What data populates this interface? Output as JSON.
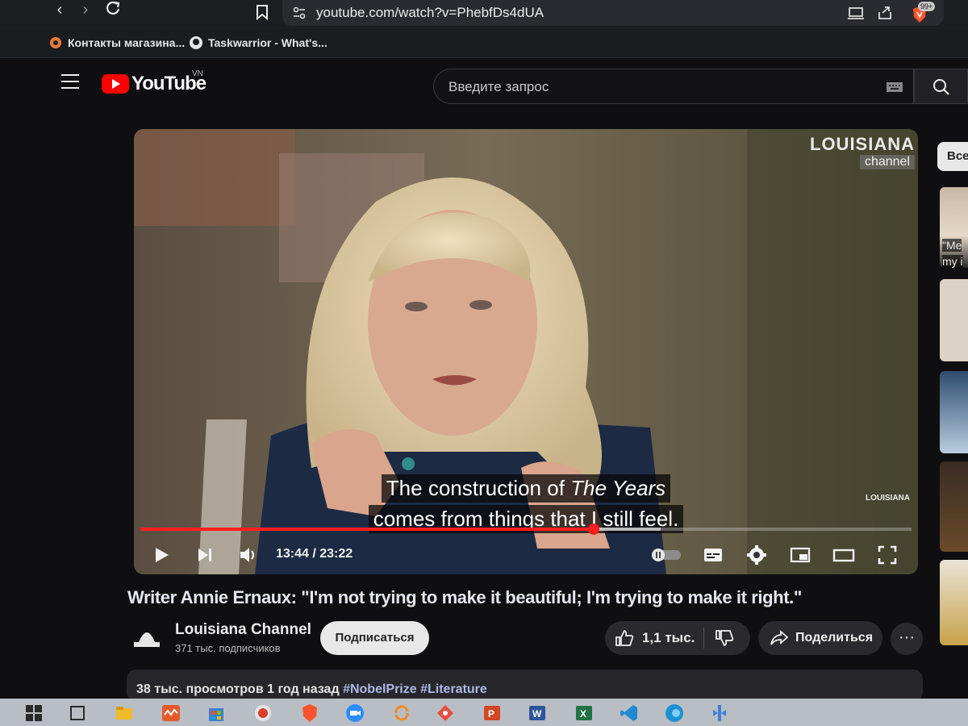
{
  "browser": {
    "url": "youtube.com/watch?v=PhebfDs4dUA",
    "badge_count": "99+",
    "bookmarks": [
      {
        "label": "Контакты магазина..."
      },
      {
        "label": "Taskwarrior - What's..."
      }
    ]
  },
  "header": {
    "logo_text": "YouTube",
    "country": "VN",
    "search_placeholder": "Введите запрос"
  },
  "player": {
    "watermark_main": "LOUISIANA",
    "watermark_sub": "channel",
    "watermark_small": "LOUISIANA",
    "caption_line1_a": "The construction of ",
    "caption_line1_b": "The Years",
    "caption_line2": "comes from things that I still feel.",
    "current_time": "13:44",
    "duration": "23:22",
    "time_display": "13:44 / 23:22",
    "progress_fraction": 0.588,
    "buffer_fraction": 0.675
  },
  "video": {
    "title": "Writer Annie Ernaux: \"I'm not trying to make it beautiful; I'm trying to make it right.\"",
    "channel_name": "Louisiana Channel",
    "subscribers": "371 тыс. подписчиков",
    "subscribe_label": "Подписаться",
    "likes": "1,1 тыс.",
    "share_label": "Поделиться",
    "more_label": "···",
    "views_date": "38 тыс. просмотров  1 год назад ",
    "tags": "#NobelPrize #Literature"
  },
  "sidebar": {
    "chip_label": "Все",
    "thumb1_text": "\"Me",
    "thumb1_text2": "my i"
  },
  "colors": {
    "accent": "#ff1e1e",
    "youtube_red": "#ff0000",
    "background": "#0f0f11"
  }
}
